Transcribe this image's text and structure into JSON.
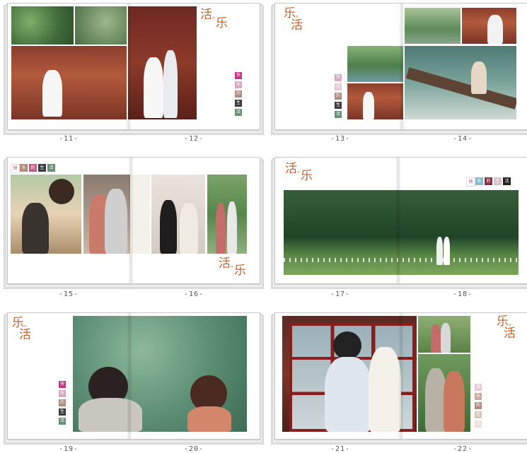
{
  "page_numbers": {
    "p11": "-11-",
    "p12": "-12-",
    "p13": "-13-",
    "p14": "-14-",
    "p15": "-15-",
    "p16": "-16-",
    "p17": "-17-",
    "p18": "-18-",
    "p19": "-19-",
    "p20": "-20-",
    "p21": "-21-",
    "p22": "-22-"
  },
  "titles": {
    "huo": "活",
    "le": "乐",
    "dot": "。"
  },
  "swatch_chars": [
    "快",
    "乐",
    "的",
    "生",
    "活"
  ],
  "colors": {
    "accent": "#c4622a",
    "swatch": [
      "#c0357f",
      "#d9a7c2",
      "#b08a7f",
      "#3a3a3a",
      "#6a8f78"
    ]
  }
}
